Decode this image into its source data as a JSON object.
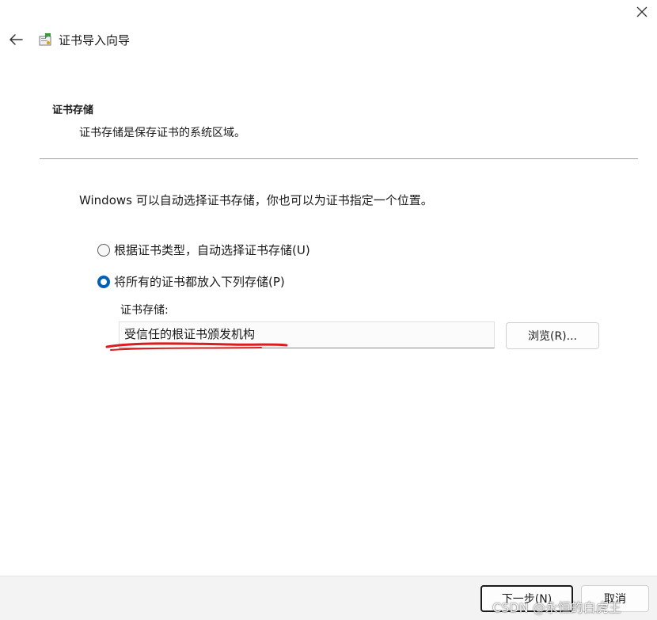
{
  "window": {
    "title": "证书导入向导"
  },
  "header": {
    "section_title": "证书存储",
    "section_desc": "证书存储是保存证书的系统区域。"
  },
  "main": {
    "intro": "Windows 可以自动选择证书存储，你也可以为证书指定一个位置。",
    "options": [
      {
        "label": "根据证书类型，自动选择证书存储(U)",
        "checked": false
      },
      {
        "label": "将所有的证书都放入下列存储(P)",
        "checked": true
      }
    ],
    "store_label": "证书存储:",
    "store_value": "受信任的根证书颁发机构",
    "browse_label": "浏览(R)..."
  },
  "footer": {
    "next_label": "下一步(N)",
    "cancel_label": "取消"
  },
  "watermark": "CSDN @永恒的白虎王",
  "colors": {
    "accent": "#005fb8",
    "annotation_red": "#d81e1e"
  }
}
